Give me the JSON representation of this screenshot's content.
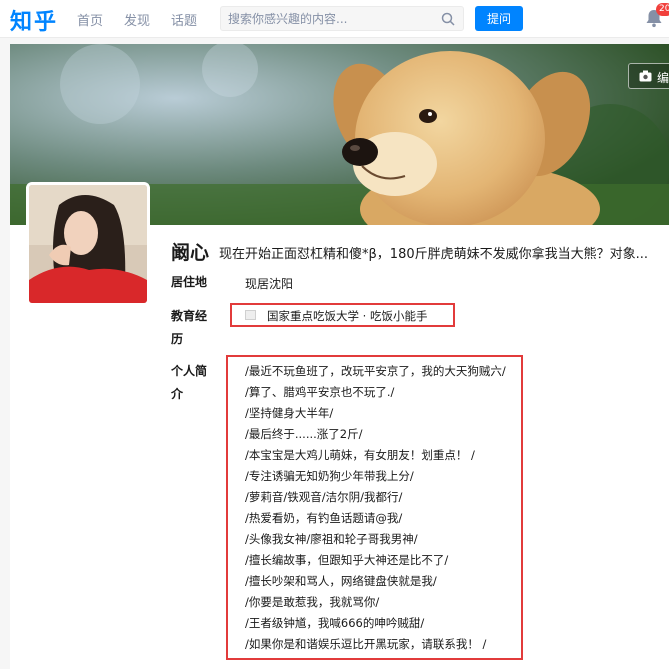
{
  "nav": {
    "logo": "知乎",
    "links": [
      "首页",
      "发现",
      "话题"
    ],
    "search_placeholder": "搜索你感兴趣的内容...",
    "ask_label": "提问",
    "notification_count": "20"
  },
  "cover": {
    "edit_label": "编"
  },
  "profile": {
    "name": "阚心",
    "headline": "现在开始正面怼杠精和傻*β，180斤胖虎萌妹不发威你拿我当大熊？对象...",
    "location_label": "居住地",
    "location_value": "现居沈阳",
    "education_label": "教育经历",
    "education_value": "国家重点吃饭大学 · 吃饭小能手",
    "bio_label": "个人简介",
    "bio_lines": [
      "/最近不玩鱼班了，改玩平安京了，我的大天狗贼六/",
      "/算了、腊鸡平安京也不玩了./",
      "/坚持健身大半年/",
      "/最后终于......涨了2斤/",
      "/本宝宝是大鸡儿萌妹，有女朋友！划重点！ /",
      "/专注诱骗无知奶狗少年带我上分/",
      "/萝莉音/铁观音/洁尔阴/我都行/",
      "/热爱看奶，有钓鱼话题请@我/",
      "/头像我女神/廖祖和轮子哥我男神/",
      "/擅长编故事，但跟知乎大神还是比不了/",
      "/擅长吵架和骂人，网络键盘侠就是我/",
      "/你要是敢惹我，我就骂你/",
      "/王者级钟馗，我喊666的呻吟贼甜/",
      "/如果你是和谐娱乐逗比开黑玩家，请联系我！ /"
    ]
  },
  "colors": {
    "brand": "#0084ff",
    "highlight_border": "#e23b3b",
    "badge": "#f1403c"
  }
}
